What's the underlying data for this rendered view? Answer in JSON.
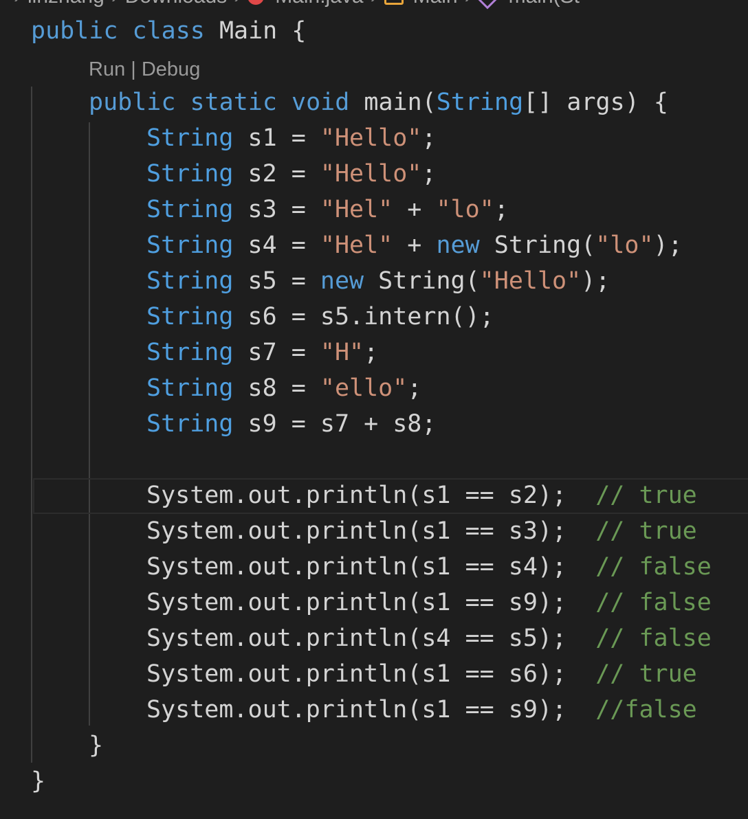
{
  "breadcrumb": [
    "linzhang",
    "Downloads",
    "Main.java",
    "Main",
    "main(St"
  ],
  "codelens": {
    "run": "Run",
    "sep": " | ",
    "debug": "Debug"
  },
  "lines": [
    {
      "indent": 0,
      "tokens": [
        [
          "kw",
          "public"
        ],
        [
          "pl",
          " "
        ],
        [
          "kw",
          "class"
        ],
        [
          "pl",
          " Main {"
        ]
      ]
    },
    {
      "indent": 1,
      "codelens": true,
      "tokens": []
    },
    {
      "indent": 1,
      "tokens": [
        [
          "kw",
          "public"
        ],
        [
          "pl",
          " "
        ],
        [
          "kw",
          "static"
        ],
        [
          "pl",
          " "
        ],
        [
          "kw",
          "void"
        ],
        [
          "pl",
          " main("
        ],
        [
          "ty",
          "String"
        ],
        [
          "pl",
          "[] args) {"
        ]
      ]
    },
    {
      "indent": 2,
      "tokens": [
        [
          "ty",
          "String"
        ],
        [
          "pl",
          " s1 = "
        ],
        [
          "str",
          "\"Hello\""
        ],
        [
          "pl",
          ";"
        ]
      ]
    },
    {
      "indent": 2,
      "tokens": [
        [
          "ty",
          "String"
        ],
        [
          "pl",
          " s2 = "
        ],
        [
          "str",
          "\"Hello\""
        ],
        [
          "pl",
          ";"
        ]
      ]
    },
    {
      "indent": 2,
      "tokens": [
        [
          "ty",
          "String"
        ],
        [
          "pl",
          " s3 = "
        ],
        [
          "str",
          "\"Hel\""
        ],
        [
          "pl",
          " + "
        ],
        [
          "str",
          "\"lo\""
        ],
        [
          "pl",
          ";"
        ]
      ]
    },
    {
      "indent": 2,
      "tokens": [
        [
          "ty",
          "String"
        ],
        [
          "pl",
          " s4 = "
        ],
        [
          "str",
          "\"Hel\""
        ],
        [
          "pl",
          " + "
        ],
        [
          "kw",
          "new"
        ],
        [
          "pl",
          " String("
        ],
        [
          "str",
          "\"lo\""
        ],
        [
          "pl",
          ");"
        ]
      ]
    },
    {
      "indent": 2,
      "tokens": [
        [
          "ty",
          "String"
        ],
        [
          "pl",
          " s5 = "
        ],
        [
          "kw",
          "new"
        ],
        [
          "pl",
          " String("
        ],
        [
          "str",
          "\"Hello\""
        ],
        [
          "pl",
          ");"
        ]
      ]
    },
    {
      "indent": 2,
      "tokens": [
        [
          "ty",
          "String"
        ],
        [
          "pl",
          " s6 = s5.intern();"
        ]
      ]
    },
    {
      "indent": 2,
      "tokens": [
        [
          "ty",
          "String"
        ],
        [
          "pl",
          " s7 = "
        ],
        [
          "str",
          "\"H\""
        ],
        [
          "pl",
          ";"
        ]
      ]
    },
    {
      "indent": 2,
      "tokens": [
        [
          "ty",
          "String"
        ],
        [
          "pl",
          " s8 = "
        ],
        [
          "str",
          "\"ello\""
        ],
        [
          "pl",
          ";"
        ]
      ]
    },
    {
      "indent": 2,
      "tokens": [
        [
          "ty",
          "String"
        ],
        [
          "pl",
          " s9 = s7 + s8;"
        ]
      ]
    },
    {
      "indent": 2,
      "tokens": []
    },
    {
      "indent": 2,
      "tokens": [
        [
          "pl",
          "System.out.println(s1 == s2);  "
        ],
        [
          "cm",
          "// true"
        ]
      ]
    },
    {
      "indent": 2,
      "tokens": [
        [
          "pl",
          "System.out.println(s1 == s3);  "
        ],
        [
          "cm",
          "// true"
        ]
      ]
    },
    {
      "indent": 2,
      "tokens": [
        [
          "pl",
          "System.out.println(s1 == s4);  "
        ],
        [
          "cm",
          "// false"
        ]
      ]
    },
    {
      "indent": 2,
      "tokens": [
        [
          "pl",
          "System.out.println(s1 == s9);  "
        ],
        [
          "cm",
          "// false"
        ]
      ]
    },
    {
      "indent": 2,
      "tokens": [
        [
          "pl",
          "System.out.println(s4 == s5);  "
        ],
        [
          "cm",
          "// false"
        ]
      ]
    },
    {
      "indent": 2,
      "tokens": [
        [
          "pl",
          "System.out.println(s1 == s6);  "
        ],
        [
          "cm",
          "// true"
        ]
      ]
    },
    {
      "indent": 2,
      "tokens": [
        [
          "pl",
          "System.out.println(s1 == s9);  "
        ],
        [
          "cm",
          "//false"
        ]
      ]
    },
    {
      "indent": 1,
      "tokens": [
        [
          "pl",
          "}"
        ]
      ]
    },
    {
      "indent": 0,
      "tokens": [
        [
          "pl",
          "}"
        ]
      ]
    }
  ]
}
